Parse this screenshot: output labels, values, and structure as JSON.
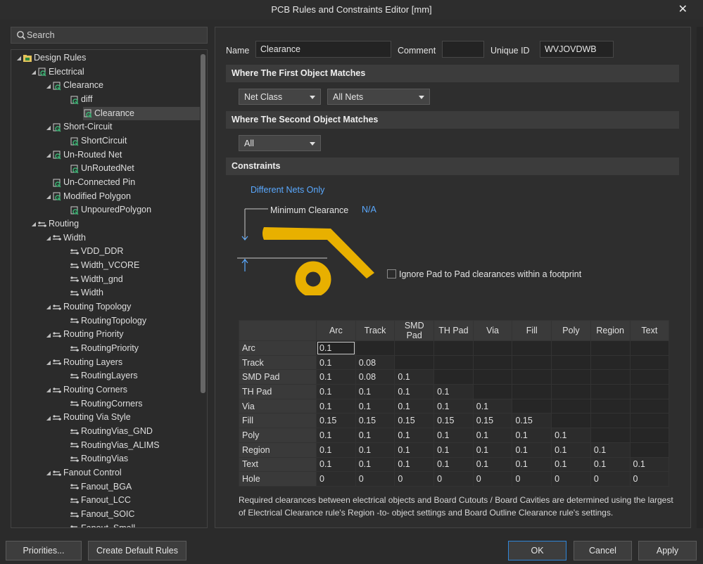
{
  "window": {
    "title": "PCB Rules and Constraints Editor [mm]",
    "close_glyph": "✕"
  },
  "search": {
    "placeholder": "Search"
  },
  "tree": [
    {
      "label": "Design Rules",
      "level": 0,
      "icon": "folder-icon",
      "expanded": true
    },
    {
      "label": "Electrical",
      "level": 1,
      "icon": "electrical-rule-icon",
      "expanded": true
    },
    {
      "label": "Clearance",
      "level": 2,
      "icon": "electrical-rule-icon",
      "expanded": true
    },
    {
      "label": "diff",
      "level": 3,
      "icon": "electrical-rule-icon"
    },
    {
      "label": "Clearance",
      "level": 3,
      "icon": "electrical-rule-icon",
      "selected": true
    },
    {
      "label": "Short-Circuit",
      "level": 2,
      "icon": "electrical-rule-icon",
      "expanded": true
    },
    {
      "label": "ShortCircuit",
      "level": 3,
      "icon": "electrical-rule-icon"
    },
    {
      "label": "Un-Routed Net",
      "level": 2,
      "icon": "electrical-rule-icon",
      "expanded": true
    },
    {
      "label": "UnRoutedNet",
      "level": 3,
      "icon": "electrical-rule-icon"
    },
    {
      "label": "Un-Connected Pin",
      "level": 2,
      "icon": "electrical-rule-icon"
    },
    {
      "label": "Modified Polygon",
      "level": 2,
      "icon": "electrical-rule-icon",
      "expanded": true
    },
    {
      "label": "UnpouredPolygon",
      "level": 3,
      "icon": "electrical-rule-icon"
    },
    {
      "label": "Routing",
      "level": 1,
      "icon": "routing-rule-icon",
      "expanded": true
    },
    {
      "label": "Width",
      "level": 2,
      "icon": "routing-rule-icon",
      "expanded": true
    },
    {
      "label": "VDD_DDR",
      "level": 3,
      "icon": "routing-rule-icon"
    },
    {
      "label": "Width_VCORE",
      "level": 3,
      "icon": "routing-rule-icon"
    },
    {
      "label": "Width_gnd",
      "level": 3,
      "icon": "routing-rule-icon"
    },
    {
      "label": "Width",
      "level": 3,
      "icon": "routing-rule-icon"
    },
    {
      "label": "Routing Topology",
      "level": 2,
      "icon": "routing-rule-icon",
      "expanded": true
    },
    {
      "label": "RoutingTopology",
      "level": 3,
      "icon": "routing-rule-icon"
    },
    {
      "label": "Routing Priority",
      "level": 2,
      "icon": "routing-rule-icon",
      "expanded": true
    },
    {
      "label": "RoutingPriority",
      "level": 3,
      "icon": "routing-rule-icon"
    },
    {
      "label": "Routing Layers",
      "level": 2,
      "icon": "routing-rule-icon",
      "expanded": true
    },
    {
      "label": "RoutingLayers",
      "level": 3,
      "icon": "routing-rule-icon"
    },
    {
      "label": "Routing Corners",
      "level": 2,
      "icon": "routing-rule-icon",
      "expanded": true
    },
    {
      "label": "RoutingCorners",
      "level": 3,
      "icon": "routing-rule-icon"
    },
    {
      "label": "Routing Via Style",
      "level": 2,
      "icon": "routing-rule-icon",
      "expanded": true
    },
    {
      "label": "RoutingVias_GND",
      "level": 3,
      "icon": "routing-rule-icon"
    },
    {
      "label": "RoutingVias_ALIMS",
      "level": 3,
      "icon": "routing-rule-icon"
    },
    {
      "label": "RoutingVias",
      "level": 3,
      "icon": "routing-rule-icon"
    },
    {
      "label": "Fanout Control",
      "level": 2,
      "icon": "routing-rule-icon",
      "expanded": true
    },
    {
      "label": "Fanout_BGA",
      "level": 3,
      "icon": "routing-rule-icon"
    },
    {
      "label": "Fanout_LCC",
      "level": 3,
      "icon": "routing-rule-icon"
    },
    {
      "label": "Fanout_SOIC",
      "level": 3,
      "icon": "routing-rule-icon"
    },
    {
      "label": "Fanout_Small",
      "level": 3,
      "icon": "routing-rule-icon"
    }
  ],
  "rule": {
    "name_label": "Name",
    "name_value": "Clearance",
    "comment_label": "Comment",
    "comment_value": "",
    "uid_label": "Unique ID",
    "uid_value": "WVJOVDWB"
  },
  "first_match": {
    "header": "Where The First Object Matches",
    "dropdown1": "Net Class",
    "dropdown2": "All Nets"
  },
  "second_match": {
    "header": "Where The Second Object Matches",
    "dropdown1": "All"
  },
  "constraints": {
    "header": "Constraints",
    "net_scope": "Different Nets Only",
    "min_clearance_label": "Minimum Clearance",
    "min_clearance_value": "N/A",
    "ignore_pad_label": "Ignore Pad to Pad clearances within a footprint"
  },
  "matrix": {
    "columns": [
      "Arc",
      "Track",
      "SMD Pad",
      "TH Pad",
      "Via",
      "Fill",
      "Poly",
      "Region",
      "Text"
    ],
    "rows": [
      {
        "name": "Arc",
        "values": [
          "0.1"
        ]
      },
      {
        "name": "Track",
        "values": [
          "0.1",
          "0.08"
        ]
      },
      {
        "name": "SMD Pad",
        "values": [
          "0.1",
          "0.08",
          "0.1"
        ]
      },
      {
        "name": "TH Pad",
        "values": [
          "0.1",
          "0.1",
          "0.1",
          "0.1"
        ]
      },
      {
        "name": "Via",
        "values": [
          "0.1",
          "0.1",
          "0.1",
          "0.1",
          "0.1"
        ]
      },
      {
        "name": "Fill",
        "values": [
          "0.15",
          "0.15",
          "0.15",
          "0.15",
          "0.15",
          "0.15"
        ]
      },
      {
        "name": "Poly",
        "values": [
          "0.1",
          "0.1",
          "0.1",
          "0.1",
          "0.1",
          "0.1",
          "0.1"
        ]
      },
      {
        "name": "Region",
        "values": [
          "0.1",
          "0.1",
          "0.1",
          "0.1",
          "0.1",
          "0.1",
          "0.1",
          "0.1"
        ]
      },
      {
        "name": "Text",
        "values": [
          "0.1",
          "0.1",
          "0.1",
          "0.1",
          "0.1",
          "0.1",
          "0.1",
          "0.1",
          "0.1"
        ]
      }
    ],
    "hole_row": {
      "name": "Hole",
      "values": [
        "0",
        "0",
        "0",
        "0",
        "0",
        "0",
        "0",
        "0",
        "0"
      ]
    }
  },
  "note": "Required clearances between electrical objects and Board Cutouts / Board Cavities are determined using the largest of Electrical Clearance rule's Region -to- object settings and Board Outline Clearance rule's settings.",
  "buttons": {
    "priorities": "Priorities...",
    "create_default": "Create Default Rules",
    "ok": "OK",
    "cancel": "Cancel",
    "apply": "Apply"
  },
  "colors": {
    "accent_link": "#5aa9ff",
    "pad_yellow": "#e8b000",
    "primary_border": "#2f86d8"
  }
}
